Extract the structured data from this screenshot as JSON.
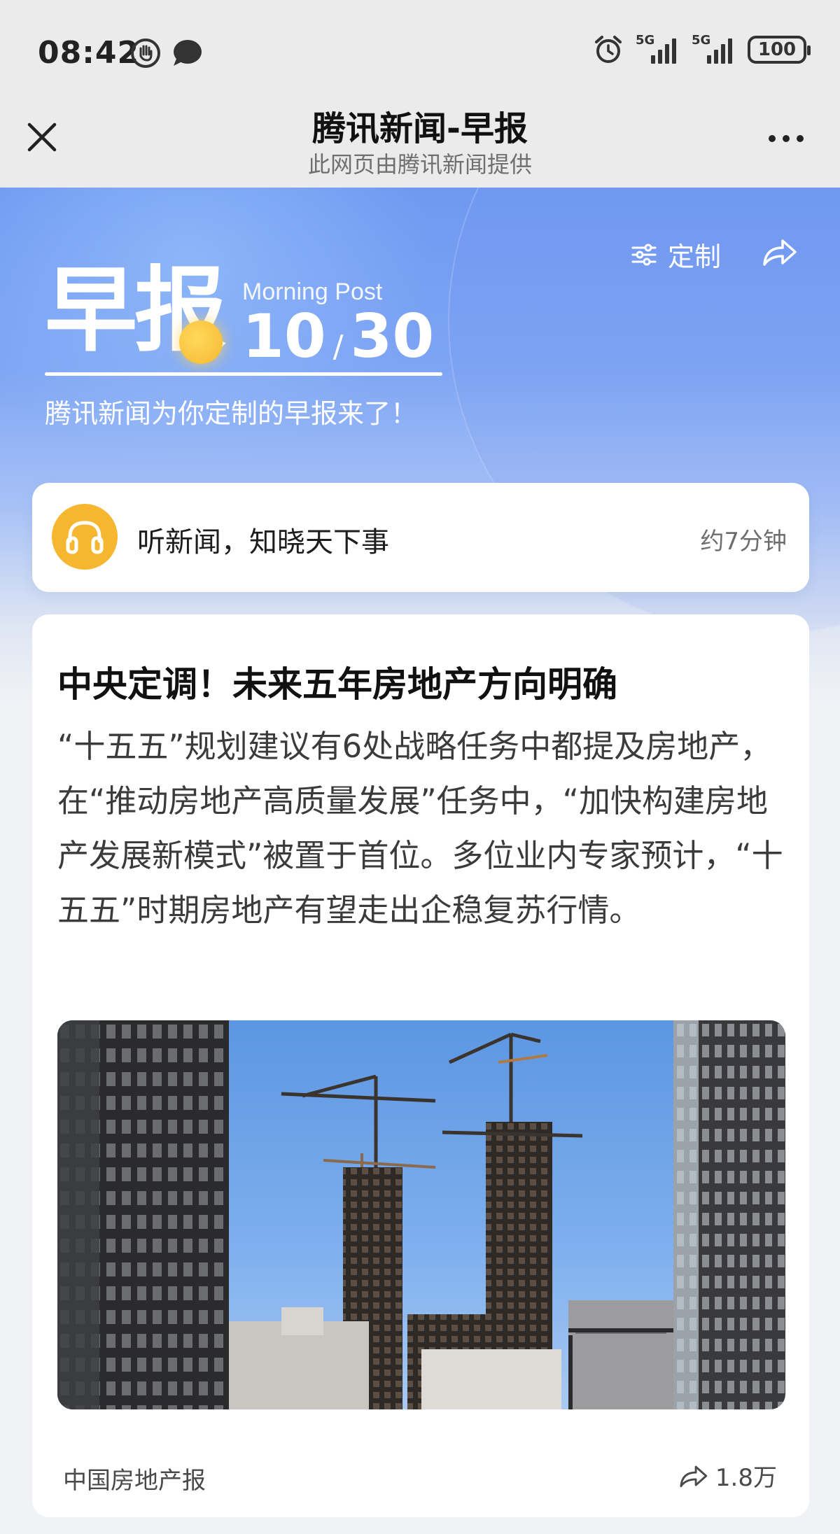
{
  "status_bar": {
    "time": "08:42",
    "battery": "100",
    "net1": "5G",
    "net2": "5G"
  },
  "header": {
    "title": "腾讯新闻-早报",
    "subtitle": "此网页由腾讯新闻提供"
  },
  "hero": {
    "customize_label": "定制",
    "brand": "早报",
    "morning_post": "Morning Post",
    "month": "10",
    "day": "30",
    "slogan": "腾讯新闻为你定制的早报来了！"
  },
  "listen": {
    "text": "听新闻，知晓天下事",
    "duration": "约7分钟"
  },
  "article": {
    "title": "中央定调！未来五年房地产方向明确",
    "summary": "“十五五”规划建议有6处战略任务中都提及房地产，在“推动房地产高质量发展”任务中，“加快构建房地产发展新模式”被置于首位。多位业内专家预计，“十五五”时期房地产有望走出企稳复苏行情。",
    "source": "中国房地产报",
    "share_count": "1.8万"
  },
  "colors": {
    "hero_blue": "#6f99f1",
    "accent_yellow": "#f6b62f"
  }
}
